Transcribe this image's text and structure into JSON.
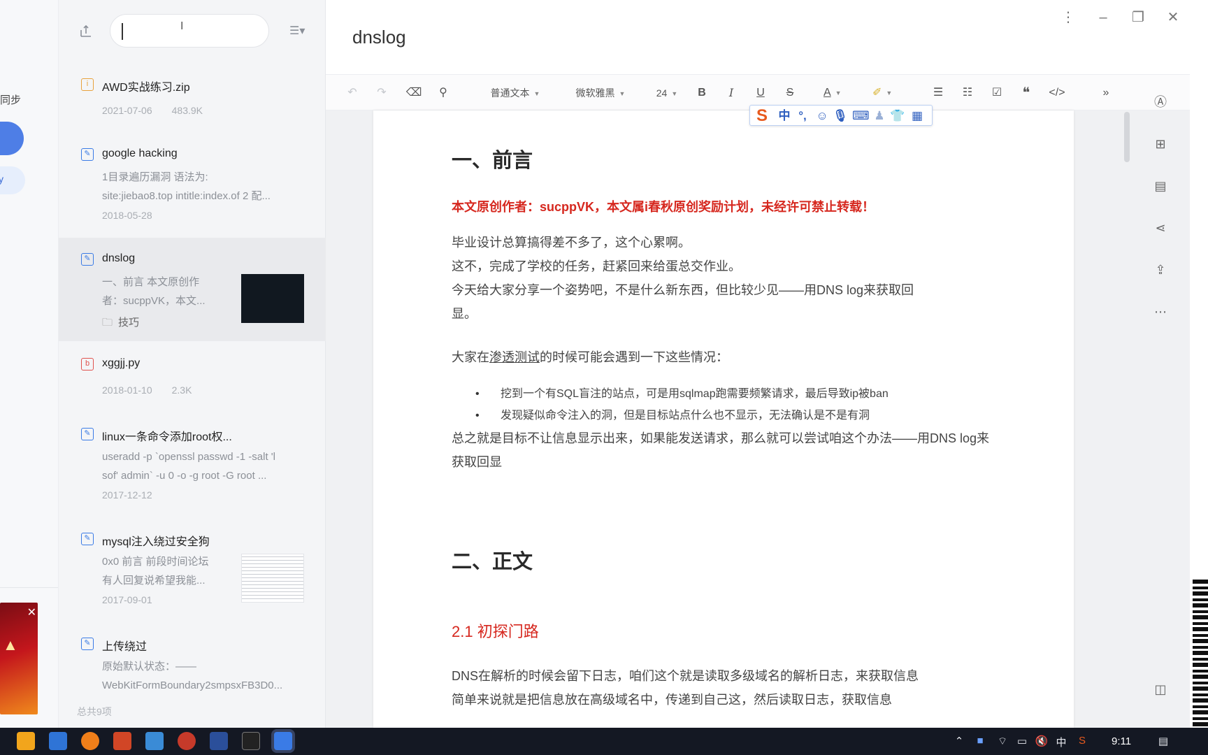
{
  "app": {
    "doc_title": "dnslog"
  },
  "leftstrip": {
    "sync_label": "同步",
    "side_label": ""
  },
  "list": {
    "search_placeholder": "",
    "footer": "总共9项",
    "notes": [
      {
        "type": "zip",
        "title": "AWD实战练习.zip",
        "date": "2021-07-06",
        "size": "483.9K"
      },
      {
        "type": "note",
        "title": "google hacking",
        "snippet1": "1目录遍历漏洞  语法为:",
        "snippet2": "site:jiebao8.top intitle:index.of 2 配...",
        "date": "2018-05-28"
      },
      {
        "type": "note",
        "title": "dnslog",
        "snippet1": "一、前言 本文原创作",
        "snippet2": "者：sucppVK，本文...",
        "folder": "技巧"
      },
      {
        "type": "py",
        "title": "xggjj.py",
        "date": "2018-01-10",
        "size": "2.3K"
      },
      {
        "type": "note",
        "title": "linux一条命令添加root权...",
        "snippet1": "useradd -p `openssl passwd -1 -salt 'l",
        "snippet2": "sof' admin` -u 0 -o -g root -G root ...",
        "date": "2017-12-12"
      },
      {
        "type": "note",
        "title": "mysql注入绕过安全狗",
        "snippet1": "0x0 前言 前段时间论坛",
        "snippet2": "有人回复说希望我能...",
        "date": "2017-09-01"
      },
      {
        "type": "note",
        "title": "上传绕过",
        "snippet1": "原始默认状态：——",
        "snippet2": "WebKitFormBoundary2smpsxFB3D0..."
      }
    ]
  },
  "toolbar": {
    "paragraph_style": "普通文本",
    "font": "微软雅黑",
    "font_size": "24"
  },
  "doc": {
    "h1_intro": "一、前言",
    "notice": "本文原创作者：sucppVK，本文属i春秋原创奖励计划，未经许可禁止转载！",
    "p1": "毕业设计总算搞得差不多了，这个心累啊。",
    "p2": "这不，完成了学校的任务，赶紧回来给蛋总交作业。",
    "p3": "今天给大家分享一个姿势吧，不是什么新东西，但比较少见——用DNS log来获取回",
    "p3b": "显。",
    "p4_pre": "大家在",
    "p4_link": "渗透测试",
    "p4_post": "的时候可能会遇到一下这些情况：",
    "bullet1": "挖到一个有SQL盲注的站点，可是用sqlmap跑需要频繁请求，最后导致ip被ban",
    "bullet2": "发现疑似命令注入的洞，但是目标站点什么也不显示，无法确认是不是有洞",
    "p5": "总之就是目标不让信息显示出来，如果能发送请求，那么就可以尝试咱这个办法——用DNS log来",
    "p5b": "获取回显",
    "h1_body": "二、正文",
    "h2_first": "2.1   初探门路",
    "p6": "DNS在解析的时候会留下日志，咱们这个就是读取多级域名的解析日志，来获取信息",
    "p7": "简单来说就是把信息放在高级域名中，传递到自己这，然后读取日志，获取信息"
  },
  "ime": {
    "lang": "中"
  },
  "taskbar": {
    "time": "9:11",
    "ime_lang": "中"
  }
}
